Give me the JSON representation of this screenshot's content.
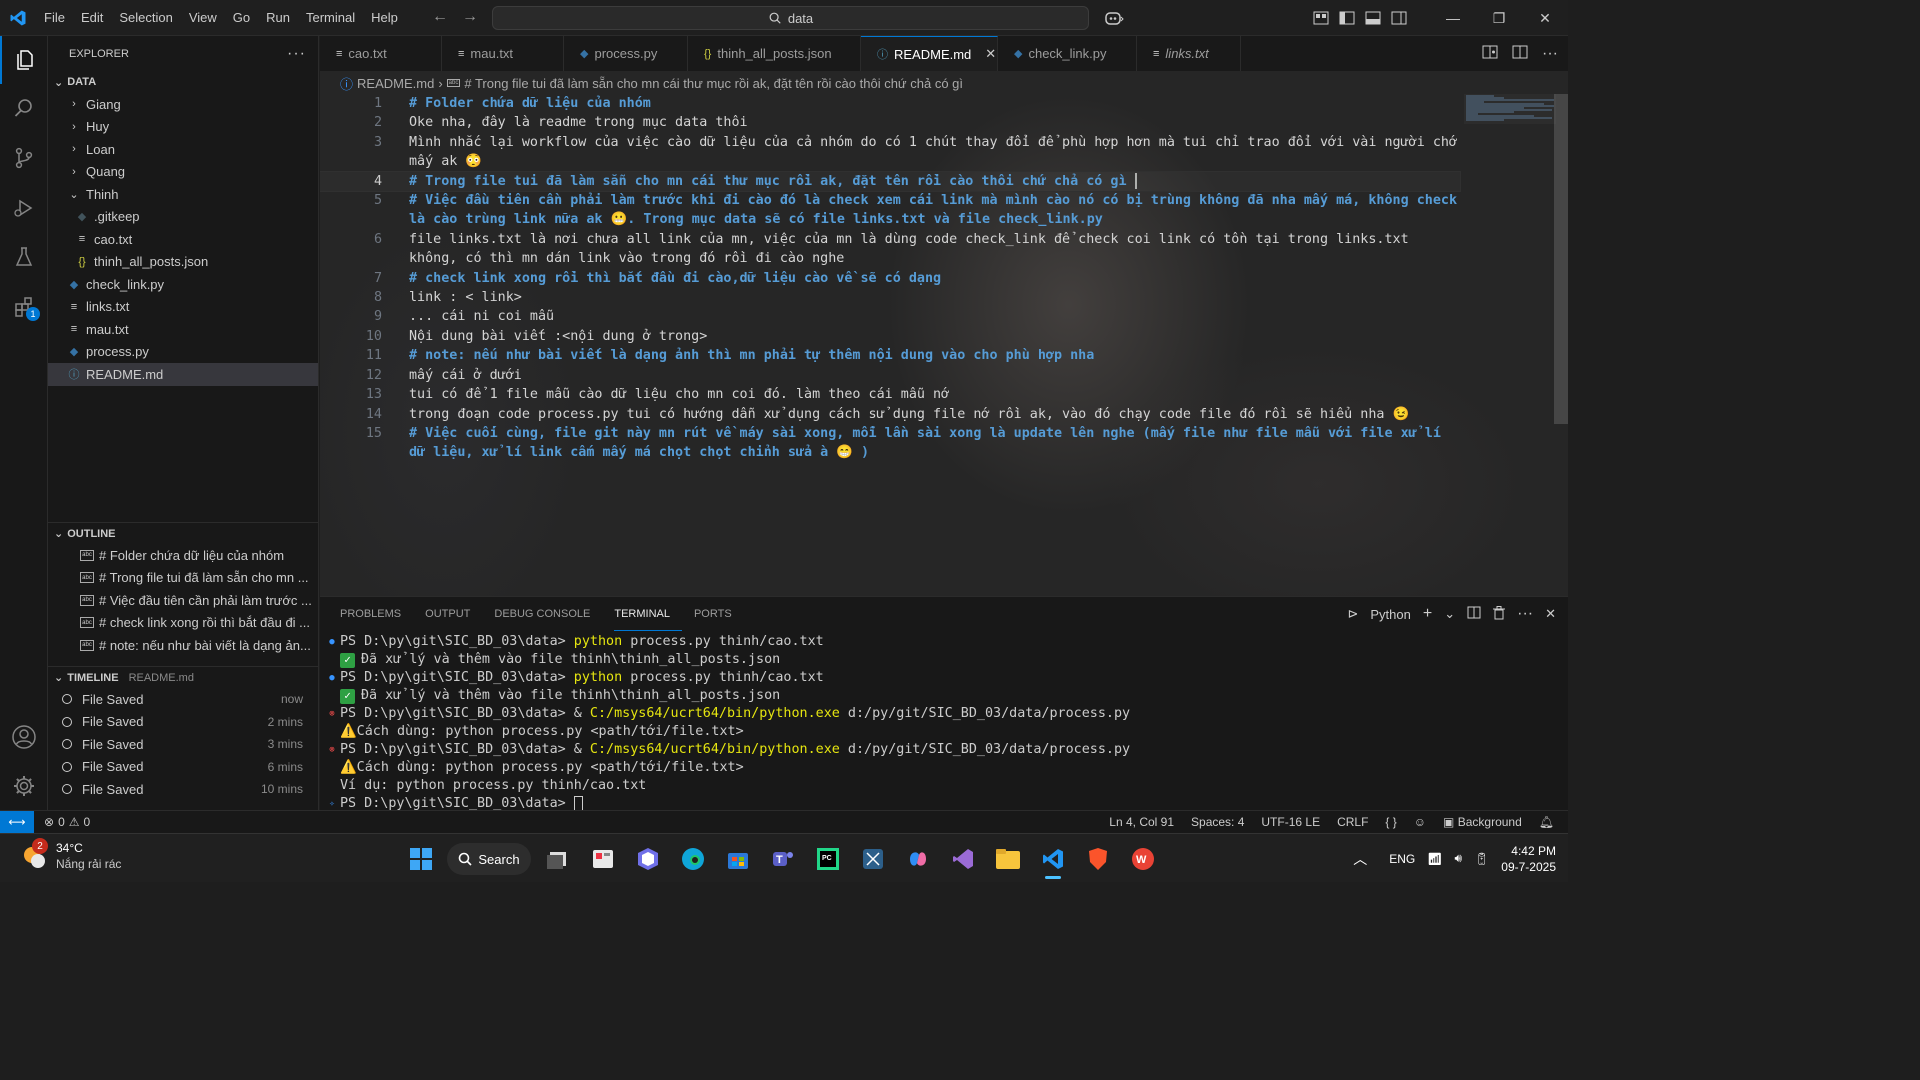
{
  "menu": [
    "File",
    "Edit",
    "Selection",
    "View",
    "Go",
    "Run",
    "Terminal",
    "Help"
  ],
  "command_center": "data",
  "activity_badge": "1",
  "explorer": {
    "title": "EXPLORER",
    "section": "DATA",
    "items": [
      {
        "label": "Giang",
        "type": "folder",
        "expanded": false,
        "depth": 1
      },
      {
        "label": "Huy",
        "type": "folder",
        "expanded": false,
        "depth": 1
      },
      {
        "label": "Loan",
        "type": "folder",
        "expanded": false,
        "depth": 1
      },
      {
        "label": "Quang",
        "type": "folder",
        "expanded": false,
        "depth": 1
      },
      {
        "label": "Thinh",
        "type": "folder",
        "expanded": true,
        "depth": 1
      },
      {
        "label": ".gitkeep",
        "type": "gitkeep",
        "depth": 2
      },
      {
        "label": "cao.txt",
        "type": "txt",
        "depth": 2
      },
      {
        "label": "thinh_all_posts.json",
        "type": "json",
        "depth": 2
      },
      {
        "label": "check_link.py",
        "type": "py",
        "depth": 1
      },
      {
        "label": "links.txt",
        "type": "txt",
        "depth": 1
      },
      {
        "label": "mau.txt",
        "type": "txt",
        "depth": 1
      },
      {
        "label": "process.py",
        "type": "py",
        "depth": 1
      },
      {
        "label": "README.md",
        "type": "md",
        "depth": 1,
        "selected": true
      }
    ]
  },
  "outline": {
    "title": "OUTLINE",
    "items": [
      "# Folder chứa dữ liệu của nhóm",
      "# Trong file tui đã làm sẵn cho mn ...",
      "# Việc đầu tiên cần phải làm trước ...",
      "# check link xong rồi thì bắt đầu đi ...",
      "# note: nếu như bài viết là dạng ản..."
    ]
  },
  "timeline": {
    "title": "TIMELINE",
    "file": "README.md",
    "items": [
      {
        "label": "File Saved",
        "ago": "now"
      },
      {
        "label": "File Saved",
        "ago": "2 mins"
      },
      {
        "label": "File Saved",
        "ago": "3 mins"
      },
      {
        "label": "File Saved",
        "ago": "6 mins"
      },
      {
        "label": "File Saved",
        "ago": "10 mins"
      }
    ]
  },
  "tabs": [
    {
      "label": "cao.txt",
      "icon": "txt"
    },
    {
      "label": "mau.txt",
      "icon": "txt"
    },
    {
      "label": "process.py",
      "icon": "py"
    },
    {
      "label": "thinh_all_posts.json",
      "icon": "json"
    },
    {
      "label": "README.md",
      "icon": "md",
      "active": true
    },
    {
      "label": "check_link.py",
      "icon": "py"
    },
    {
      "label": "links.txt",
      "icon": "txt",
      "italic": true
    }
  ],
  "breadcrumb": {
    "file": "README.md",
    "symbol": "# Trong file tui đã làm sẵn cho mn cái thư mục rồi ak, đặt tên rồi cào thôi chứ chả có gì"
  },
  "code_lines": [
    {
      "n": "1",
      "text": "# Folder chứa dữ liệu của nhóm",
      "heading": true
    },
    {
      "n": "2",
      "text": "Oke nha, đây là readme trong mục data thôi"
    },
    {
      "n": "3",
      "text": "Mình nhắc lại workflow của việc cào dữ liệu của cả nhóm do có 1 chút thay đổi để phù hợp hơn mà tui chỉ trao đổi với vài người chớ mấy ak 😳"
    },
    {
      "n": "4",
      "text": "# Trong file tui đã làm sẵn cho mn cái thư mục rồi ak, đặt tên rồi cào thôi chứ chả có gì ",
      "heading": true,
      "current": true
    },
    {
      "n": "5",
      "text": "# Việc đầu tiên cần phải làm trước khi đi cào đó là check xem cái link mà mình cào nó có bị trùng không đã nha mấy má, không check là cào trùng link nữa ak 😬. Trong mục data sẽ có file links.txt và file check_link.py",
      "heading": true
    },
    {
      "n": "6",
      "text": "file links.txt là nơi chưa all link của mn, việc của mn là dùng code check_link để check coi link có tồn tại trong links.txt không, có thì mn dán link vào trong đó rồi đi cào nghe"
    },
    {
      "n": "7",
      "text": "# check link xong rồi thì bắt đầu đi cào,dữ liệu cào về sẽ có dạng",
      "heading": true
    },
    {
      "n": "8",
      "text": "link : < link>"
    },
    {
      "n": "9",
      "text": "... cái ni coi mẫu"
    },
    {
      "n": "10",
      "text": "Nội dung bài viết :<nội dung ở trong>"
    },
    {
      "n": "11",
      "text": "# note: nếu như bài viết là dạng ảnh thì mn phải tự thêm nội dung vào cho phù hợp nha",
      "heading": true
    },
    {
      "n": "12",
      "text": "mấy cái ở dưới"
    },
    {
      "n": "13",
      "text": "tui có để 1 file mẫu cào dữ liệu cho mn coi đó. làm theo cái mẫu nớ"
    },
    {
      "n": "14",
      "text": "trong đoạn code process.py tui có hướng dẫn xử dụng cách sử dụng file nớ rồi ak, vào đó chạy code file đó rồi sẽ hiểu nha 😉"
    },
    {
      "n": "15",
      "text": "# Việc cuối cùng, file git này mn rút về máy sài xong, mỗi lần sài xong là update lên nghe (mấy file như file mẫu với file xử lí dữ liệu, xử lí link cấm mấy má chọt chọt chỉnh sửa à 😁 )",
      "heading": true
    }
  ],
  "panel": {
    "tabs": [
      "PROBLEMS",
      "OUTPUT",
      "DEBUG CONSOLE",
      "TERMINAL",
      "PORTS"
    ],
    "active_tab": "TERMINAL",
    "shell": "Python"
  },
  "terminal": [
    {
      "dot": "blue",
      "prompt": "PS D:\\py\\git\\SIC_BD_03\\data> ",
      "cmd": "python",
      "rest": " process.py thinh/cao.txt"
    },
    {
      "dot": "",
      "check": true,
      "rest": "Đã xử lý và thêm vào file thinh\\thinh_all_posts.json"
    },
    {
      "dot": "blue",
      "prompt": "PS D:\\py\\git\\SIC_BD_03\\data> ",
      "cmd": "python",
      "rest": " process.py thinh/cao.txt"
    },
    {
      "dot": "",
      "check": true,
      "rest": "Đã xử lý và thêm vào file thinh\\thinh_all_posts.json"
    },
    {
      "dot": "red",
      "prompt": "PS D:\\py\\git\\SIC_BD_03\\data> & ",
      "cmd": "C:/msys64/ucrt64/bin/python.exe",
      "rest": " d:/py/git/SIC_BD_03/data/process.py"
    },
    {
      "dot": "",
      "rest": "⚠️Cách dùng: python process.py <path/tới/file.txt>"
    },
    {
      "dot": "red",
      "prompt": "PS D:\\py\\git\\SIC_BD_03\\data> & ",
      "cmd": "C:/msys64/ucrt64/bin/python.exe",
      "rest": " d:/py/git/SIC_BD_03/data/process.py"
    },
    {
      "dot": "",
      "rest": "⚠️Cách dùng: python process.py <path/tới/file.txt>"
    },
    {
      "dot": "",
      "rest": "Ví dụ: python process.py thinh/cao.txt"
    },
    {
      "dot": "spark",
      "prompt": "PS D:\\py\\git\\SIC_BD_03\\data> ",
      "cursor": true
    }
  ],
  "status": {
    "errors": "0",
    "warnings": "0",
    "position": "Ln 4, Col 91",
    "spaces": "Spaces: 4",
    "encoding": "UTF-16 LE",
    "eol": "CRLF",
    "language": "{ }",
    "background": "Background"
  },
  "taskbar": {
    "weather_temp": "34°C",
    "weather_desc": "Nắng rải rác",
    "weather_badge": "2",
    "search": "Search",
    "lang": "ENG",
    "time": "4:42 PM",
    "date": "09-7-2025"
  },
  "colors": {
    "accent": "#0078d4",
    "heading": "#569cd6",
    "terminal_cmd": "#e5e510"
  }
}
